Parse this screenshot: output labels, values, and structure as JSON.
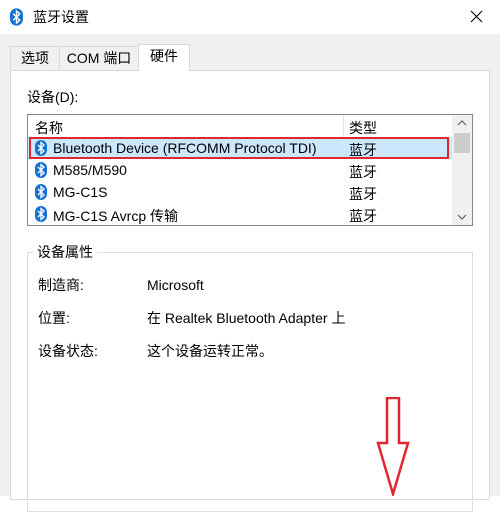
{
  "window": {
    "title": "蓝牙设置"
  },
  "tabs": [
    {
      "label": "选项"
    },
    {
      "label": "COM 端口"
    },
    {
      "label": "硬件"
    }
  ],
  "devices": {
    "label": "设备(D):",
    "columns": [
      "名称",
      "类型"
    ],
    "rows": [
      {
        "name": "Bluetooth Device (RFCOMM Protocol TDI)",
        "type": "蓝牙",
        "selected": true
      },
      {
        "name": "M585/M590",
        "type": "蓝牙"
      },
      {
        "name": "MG-C1S",
        "type": "蓝牙"
      },
      {
        "name": "MG-C1S Avrcp 传输",
        "type": "蓝牙"
      }
    ]
  },
  "properties": {
    "title": "设备属性",
    "items": [
      {
        "label": "制造商:",
        "value": "Microsoft"
      },
      {
        "label": "位置:",
        "value": "在 Realtek Bluetooth Adapter 上"
      },
      {
        "label": "设备状态:",
        "value": "这个设备运转正常。"
      }
    ]
  },
  "colors": {
    "bluetooth_icon": "#1572d3",
    "selection_bg": "#cce8ff",
    "highlight_outline": "#e0262f"
  }
}
